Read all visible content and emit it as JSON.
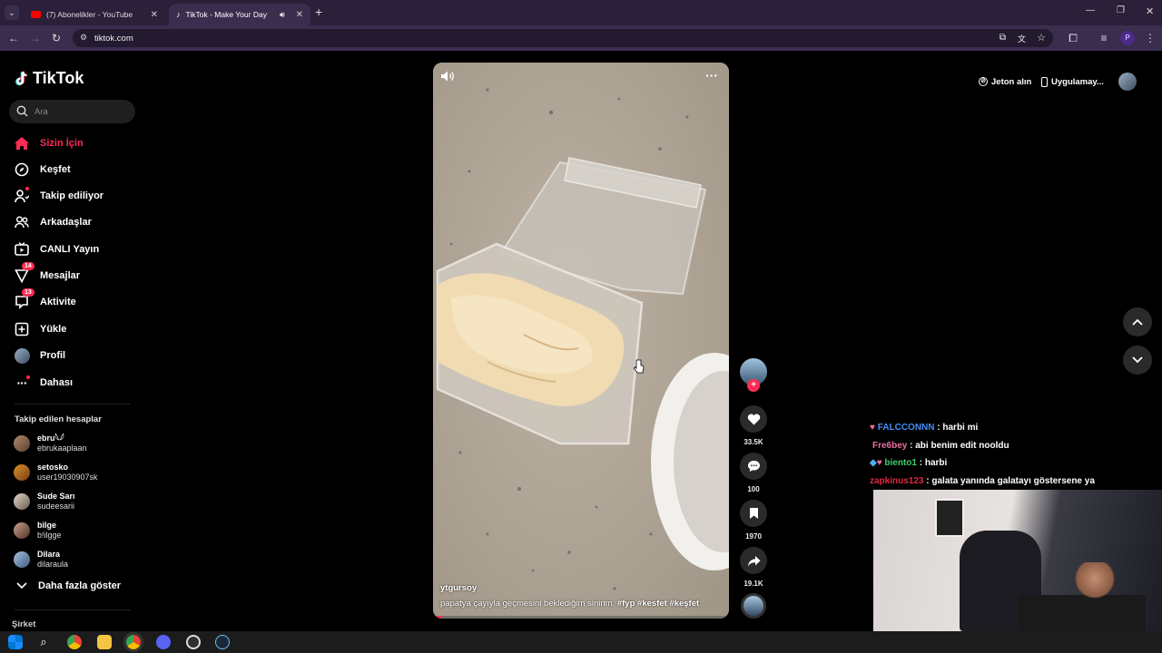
{
  "browser": {
    "tabs": [
      {
        "title": "(7) Abonelikler - YouTube",
        "active": false
      },
      {
        "title": "TikTok - Make Your Day",
        "active": true
      }
    ],
    "url": "tiktok.com",
    "profile_initial": "P"
  },
  "sidebar": {
    "logo_text": "TikTok",
    "search_placeholder": "Ara",
    "nav": [
      {
        "label": "Sizin İçin",
        "icon": "home-icon",
        "active": true
      },
      {
        "label": "Keşfet",
        "icon": "compass-icon"
      },
      {
        "label": "Takip ediliyor",
        "icon": "following-icon"
      },
      {
        "label": "Arkadaşlar",
        "icon": "friends-icon"
      },
      {
        "label": "CANLI Yayın",
        "icon": "live-icon"
      },
      {
        "label": "Mesajlar",
        "icon": "messages-icon",
        "badge": "14"
      },
      {
        "label": "Aktivite",
        "icon": "activity-icon",
        "badge": "13"
      },
      {
        "label": "Yükle",
        "icon": "upload-icon"
      },
      {
        "label": "Profil",
        "icon": "profile-avatar-icon"
      },
      {
        "label": "Dahası",
        "icon": "more-icon"
      }
    ],
    "following_title": "Takip edilen hesaplar",
    "following": [
      {
        "name": "ebru𓆩𓆪",
        "username": "ebrukaaplaan"
      },
      {
        "name": "setosko",
        "username": "user19030907sk"
      },
      {
        "name": "Sude Sarı",
        "username": "sudeesarii"
      },
      {
        "name": "bilge",
        "username": "b!ilgge"
      },
      {
        "name": "Dilara",
        "username": "dilaraula"
      }
    ],
    "show_more": "Daha fazla göster",
    "company": "Şirket"
  },
  "video": {
    "author": "ytgursoy",
    "caption": "papatya çayıyla geçmesini beklediğim sinirim.",
    "hashtags": [
      "#fyp",
      "#kesfet",
      "#keşfet"
    ],
    "progress_fraction": 0.03
  },
  "actions": {
    "likes": "33.5K",
    "comments": "100",
    "saves": "1970",
    "shares": "19.1K"
  },
  "topright": {
    "coins": "Jeton alın",
    "app": "Uygulamay..."
  },
  "chat": [
    {
      "user": "FALCCONNN",
      "msg": "harbi mi",
      "color": "#4a8df5"
    },
    {
      "user": "Fre6bey",
      "msg": "abi benim edit nooldu",
      "color": "#e86fa0"
    },
    {
      "user": "biento1",
      "msg": "harbi",
      "color": "#3ecf6a"
    },
    {
      "user": "zapkinus123",
      "msg": "galata yanında galatayı göstersene ya",
      "color": "#e0283f"
    }
  ]
}
